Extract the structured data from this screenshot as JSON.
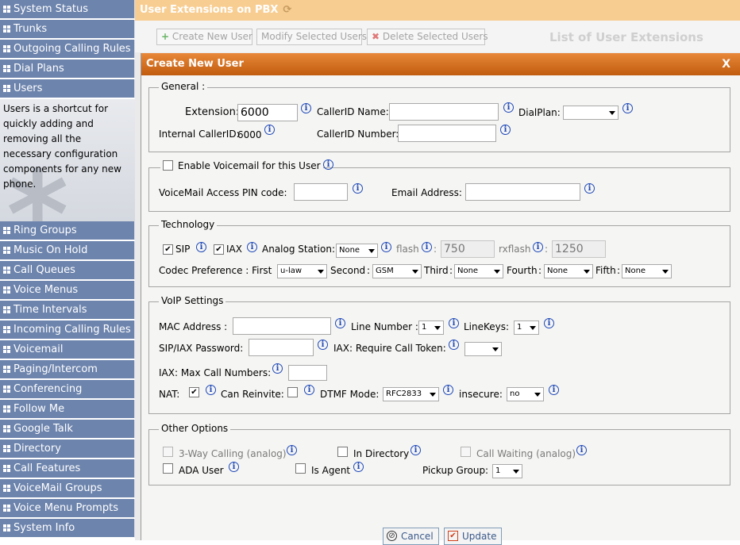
{
  "sidebar": {
    "items": [
      "System Status",
      "Trunks",
      "Outgoing Calling Rules",
      "Dial Plans",
      "Users",
      "Ring Groups",
      "Music On Hold",
      "Call Queues",
      "Voice Menus",
      "Time Intervals",
      "Incoming Calling Rules",
      "Voicemail",
      "Paging/Intercom",
      "Conferencing",
      "Follow Me",
      "Google Talk",
      "Directory",
      "Call Features",
      "VoiceMail Groups",
      "Voice Menu Prompts",
      "System Info"
    ],
    "users_description": "Users is a shortcut for quickly adding and removing all the necessary configuration components for any new phone."
  },
  "header": {
    "title": "User Extensions on PBX"
  },
  "toolbar": {
    "create": "Create New User",
    "modify": "Modify Selected Users",
    "delete": "Delete Selected Users",
    "list_title": "List of User Extensions"
  },
  "dialog": {
    "title": "Create New User",
    "close": "X",
    "general": {
      "legend": "General :",
      "extension_label": "Extension:",
      "extension_value": "6000",
      "callerid_name_label": "CallerID Name:",
      "dialplan_label": "DialPlan:",
      "internal_callerid_label": "Internal CallerID:",
      "internal_callerid_value": "6000",
      "callerid_number_label": "CallerID Number:"
    },
    "voicemail": {
      "enable_label": "Enable Voicemail for this User",
      "pin_label": "VoiceMail Access PIN code:",
      "email_label": "Email Address:"
    },
    "technology": {
      "legend": "Technology",
      "sip_label": "SIP",
      "iax_label": "IAX",
      "analog_label": "Analog Station:",
      "analog_value": "None",
      "flash_label": "flash",
      "flash_value": "750",
      "rxflash_label": "rxflash",
      "rxflash_value": "1250",
      "colon": ":",
      "codec_label": "Codec Preference : First",
      "first": "u-law",
      "second_label": "Second",
      "second": "GSM",
      "third_label": "Third",
      "third": "None",
      "fourth_label": "Fourth",
      "fourth": "None",
      "fifth_label": "Fifth",
      "fifth": "None"
    },
    "voip": {
      "legend": "VoIP Settings",
      "mac_label": "MAC Address :",
      "line_number_label": "Line Number :",
      "line_number_value": "1",
      "linekeys_label": "LineKeys:",
      "linekeys_value": "1",
      "password_label": "SIP/IAX Password:",
      "token_label": "IAX: Require Call Token:",
      "max_calls_label": "IAX: Max Call Numbers:",
      "nat_label": "NAT:",
      "reinvite_label": "Can Reinvite:",
      "dtmf_label": "DTMF Mode:",
      "dtmf_value": "RFC2833",
      "insecure_label": "insecure:",
      "insecure_value": "no"
    },
    "other": {
      "legend": "Other Options",
      "three_way": "3-Way Calling (analog)",
      "in_directory": "In Directory",
      "call_waiting": "Call Waiting (analog)",
      "ada_user": "ADA User",
      "is_agent": "Is Agent",
      "pickup_label": "Pickup Group:",
      "pickup_value": "1"
    },
    "cancel": "Cancel",
    "update": "Update"
  },
  "colors": {
    "sidebar": "#6d84ad",
    "header": "#f8cd91",
    "titlebar": "#d06a1e",
    "info": "#1e48b8"
  }
}
